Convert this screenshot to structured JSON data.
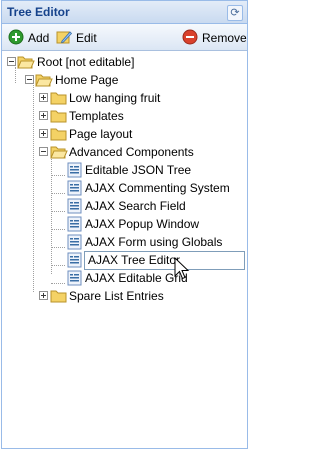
{
  "panel": {
    "title": "Tree Editor"
  },
  "toolbar": {
    "add_label": "Add",
    "edit_label": "Edit",
    "remove_label": "Remove"
  },
  "tree": {
    "root": "Root [not editable]",
    "home": "Home Page",
    "low_hanging_fruit": "Low hanging fruit",
    "templates": "Templates",
    "page_layout": "Page layout",
    "advanced_components": "Advanced Components",
    "editable_json_tree": "Editable JSON Tree",
    "ajax_commenting_system": "AJAX Commenting System",
    "ajax_search_field": "AJAX Search Field",
    "ajax_popup_window": "AJAX Popup Window",
    "ajax_form_using_globals": "AJAX Form using Globals",
    "ajax_tree_editor": "AJAX Tree Editor",
    "ajax_editable_grid": "AJAX Editable Grid",
    "spare_list_entries": "Spare List Entries"
  },
  "colors": {
    "title_text": "#15428b",
    "border": "#99bbe8",
    "folder": "#f4d265",
    "add_green": "#2e9a2e",
    "remove_red": "#d9412d"
  }
}
